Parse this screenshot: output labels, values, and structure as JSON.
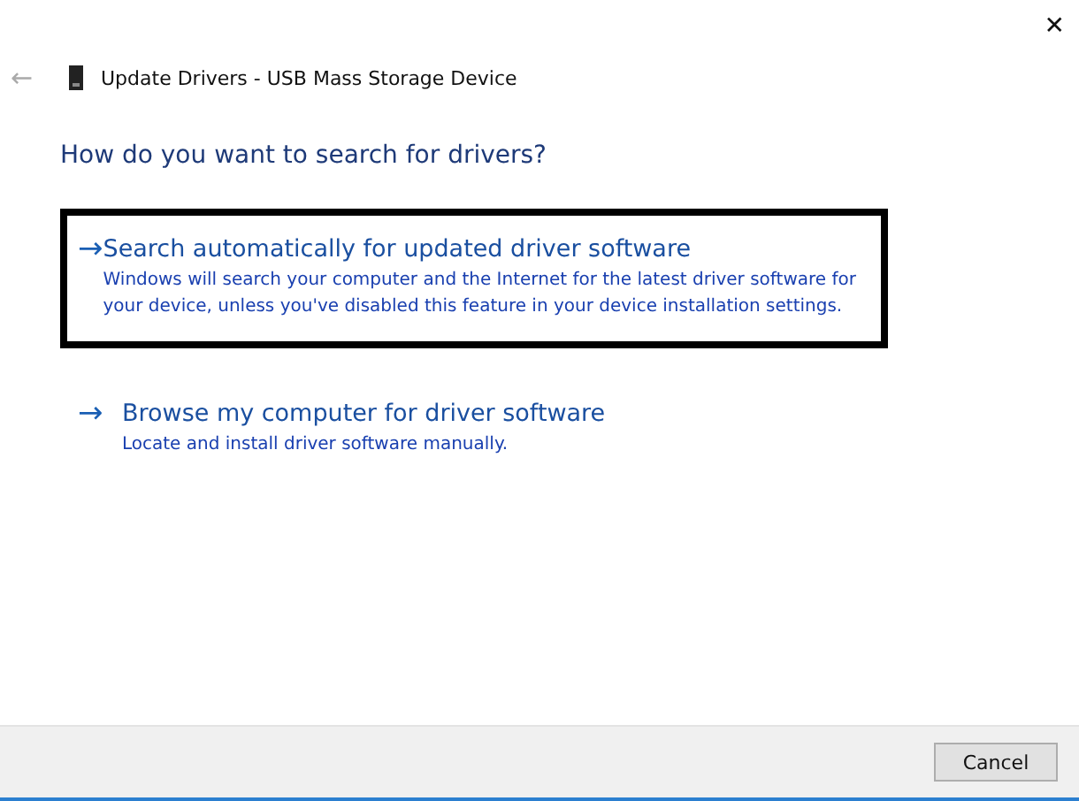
{
  "window": {
    "title": "Update Drivers - USB Mass Storage Device",
    "close": "✕",
    "back": "←"
  },
  "heading": "How do you want to search for drivers?",
  "options": [
    {
      "arrow": "→",
      "title": "Search automatically for updated driver software",
      "description": "Windows will search your computer and the Internet for the latest driver software for your device, unless you've disabled this feature in your device installation settings.",
      "selected": true
    },
    {
      "arrow": "→",
      "title": "Browse my computer for driver software",
      "description": "Locate and install driver software manually.",
      "selected": false
    }
  ],
  "buttons": [
    "Cancel"
  ]
}
